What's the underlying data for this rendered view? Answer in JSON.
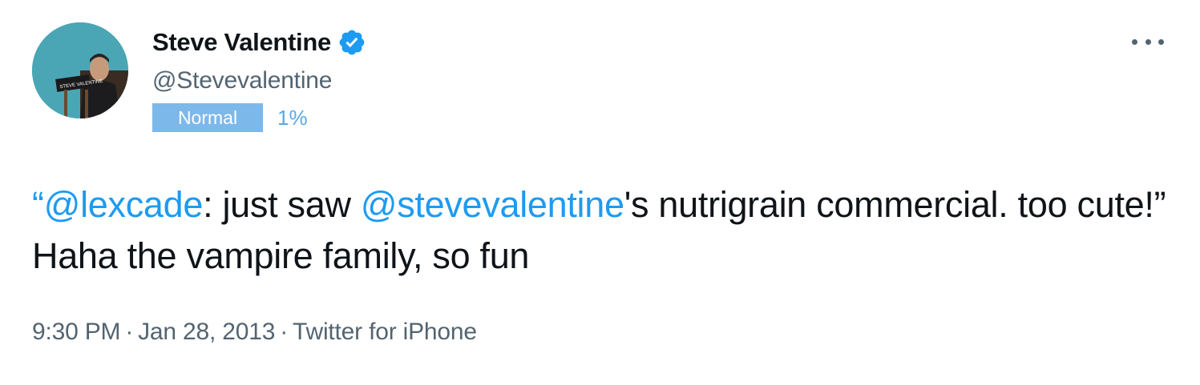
{
  "author": {
    "display_name": "Steve Valentine",
    "handle": "@Stevevalentine",
    "avatar_sign_text": "STEVE VALENTINE",
    "verified_icon": "verified-badge-icon"
  },
  "badge": {
    "label": "Normal",
    "percent": "1%"
  },
  "tweet": {
    "open_quote": "“",
    "mention1": "@lexcade",
    "text1": ": just saw ",
    "mention2": "@stevevalentine",
    "text2": "'s nutrigrain commercial. too cute!” Haha the vampire family, so fun"
  },
  "meta": {
    "time": "9:30 PM",
    "date": "Jan 28, 2013",
    "source": "Twitter for iPhone",
    "separator": "·"
  },
  "menu": {
    "icon": "more-options-icon"
  },
  "colors": {
    "mention": "#1d9bf0",
    "badge_bg": "#7db8ea",
    "percent": "#5aa7e6",
    "secondary_text": "#536471",
    "avatar_bg": "#4aa6b4"
  }
}
